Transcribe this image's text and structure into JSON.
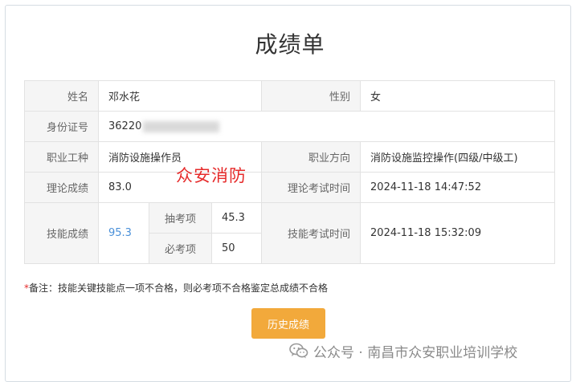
{
  "page": {
    "title": "成绩单"
  },
  "rows": {
    "name_label": "姓名",
    "name_value": "邓水花",
    "gender_label": "性别",
    "gender_value": "女",
    "id_label": "身份证号",
    "id_value_visible": "36220",
    "occupation_label": "职业工种",
    "occupation_value": "消防设施操作员",
    "direction_label": "职业方向",
    "direction_value": "消防设施监控操作(四级/中级工)",
    "theory_label": "理论成绩",
    "theory_value": "83.0",
    "theory_time_label": "理论考试时间",
    "theory_time_value": "2024-11-18 14:47:52",
    "skill_label": "技能成绩",
    "skill_value": "95.3",
    "sample_label": "抽考项",
    "sample_value": "45.3",
    "required_label": "必考项",
    "required_value": "50",
    "skill_time_label": "技能考试时间",
    "skill_time_value": "2024-11-18 15:32:09"
  },
  "overlay_text": "众安消防",
  "note": {
    "star": "*",
    "text": "备注：技能关键技能点一项不合格，则必考项不合格鉴定总成绩不合格"
  },
  "buttons": {
    "history_label": "历史成绩"
  },
  "watermark": {
    "text": "公众号 · 南昌市众安职业培训学校",
    "icon": "wechat-icon"
  },
  "colors": {
    "button": "#f2a93b",
    "skill_score": "#4a90d9",
    "note_star": "#e62b2b",
    "label_bg": "#f5f5f5"
  }
}
